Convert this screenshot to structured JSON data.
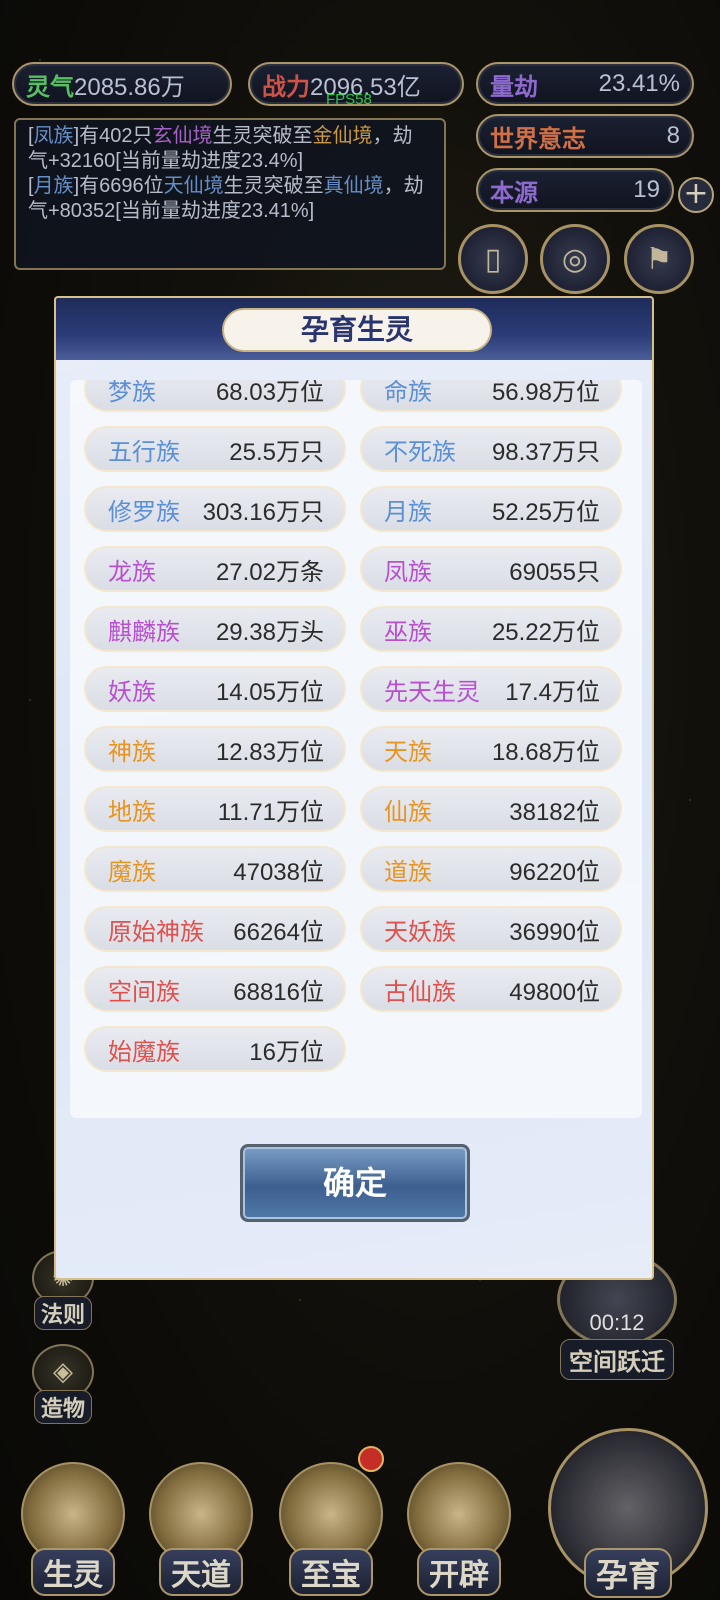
{
  "stats": {
    "lingqi": {
      "label": "灵气",
      "value": "2085.86万"
    },
    "zhanli": {
      "label": "战力",
      "value": "2096.53亿"
    },
    "liangjie": {
      "label": "量劫",
      "value": "23.41%"
    },
    "shijie": {
      "label": "世界意志",
      "value": "8"
    },
    "benyuan": {
      "label": "本源",
      "value": "19"
    }
  },
  "fps": "FPS58",
  "log": {
    "line1": {
      "open": "[",
      "race": "凤族",
      "mid": "]有402只",
      "realm_from": "玄仙境",
      "mid2": "生灵突破至",
      "realm_to": "金仙境",
      "rest": "，劫气+32160[当前量劫进度23.4%]"
    },
    "line2": {
      "open": "[",
      "race": "月族",
      "mid": "]有6696位",
      "realm_from": "天仙境",
      "mid2": "生灵突破至",
      "realm_to": "真仙境",
      "rest": "，劫气+80352[当前量劫进度23.41%]"
    }
  },
  "modal": {
    "title": "孕育生灵",
    "confirm_label": "确定",
    "races": [
      {
        "name": "梦族",
        "count": "68.03万位",
        "color": "#5b8fd6"
      },
      {
        "name": "命族",
        "count": "56.98万位",
        "color": "#5b8fd6"
      },
      {
        "name": "五行族",
        "count": "25.5万只",
        "color": "#5b8fd6"
      },
      {
        "name": "不死族",
        "count": "98.37万只",
        "color": "#5b8fd6"
      },
      {
        "name": "修罗族",
        "count": "303.16万只",
        "color": "#5b8fd6"
      },
      {
        "name": "月族",
        "count": "52.25万位",
        "color": "#5b8fd6"
      },
      {
        "name": "龙族",
        "count": "27.02万条",
        "color": "#b84fd0"
      },
      {
        "name": "凤族",
        "count": "69055只",
        "color": "#b84fd0"
      },
      {
        "name": "麒麟族",
        "count": "29.38万头",
        "color": "#b84fd0"
      },
      {
        "name": "巫族",
        "count": "25.22万位",
        "color": "#b84fd0"
      },
      {
        "name": "妖族",
        "count": "14.05万位",
        "color": "#b84fd0"
      },
      {
        "name": "先天生灵",
        "count": "17.4万位",
        "color": "#b84fd0"
      },
      {
        "name": "神族",
        "count": "12.83万位",
        "color": "#e89420"
      },
      {
        "name": "天族",
        "count": "18.68万位",
        "color": "#e89420"
      },
      {
        "name": "地族",
        "count": "11.71万位",
        "color": "#e89420"
      },
      {
        "name": "仙族",
        "count": "38182位",
        "color": "#e89420"
      },
      {
        "name": "魔族",
        "count": "47038位",
        "color": "#e89420"
      },
      {
        "name": "道族",
        "count": "96220位",
        "color": "#e89420"
      },
      {
        "name": "原始神族",
        "count": "66264位",
        "color": "#e0504c"
      },
      {
        "name": "天妖族",
        "count": "36990位",
        "color": "#e0504c"
      },
      {
        "name": "空间族",
        "count": "68816位",
        "color": "#e0504c"
      },
      {
        "name": "古仙族",
        "count": "49800位",
        "color": "#e0504c"
      },
      {
        "name": "始魔族",
        "count": "16万位",
        "color": "#e0504c"
      }
    ]
  },
  "side_menu": {
    "fa_ze": "法则",
    "zao_wu": "造物"
  },
  "space_jump": {
    "timer": "00:12",
    "label": "空间跃迁"
  },
  "bottom_nav": {
    "sheng_ling": "生灵",
    "tian_dao": "天道",
    "zhi_bao": "至宝",
    "kai_pi": "开辟",
    "yun_yu": "孕育"
  }
}
